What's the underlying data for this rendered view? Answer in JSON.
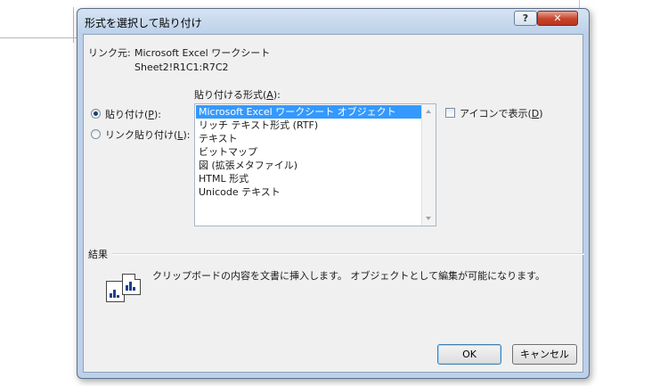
{
  "dialog": {
    "title": "形式を選択して貼り付け",
    "help_label": "?",
    "close_label": "✕"
  },
  "link": {
    "label": "リンク元:",
    "source": "Microsoft Excel ワークシート",
    "range": "Sheet2!R1C1:R7C2"
  },
  "paste_format": {
    "label": "貼り付ける形式(",
    "accesskey": "A",
    "label_end": "):"
  },
  "options": {
    "paste": {
      "label": "貼り付け(",
      "accesskey": "P",
      "label_end": "):",
      "selected": true
    },
    "paste_link": {
      "label": "リンク貼り付け(",
      "accesskey": "L",
      "label_end": "):",
      "selected": false
    }
  },
  "format_list": [
    {
      "label": "Microsoft Excel ワークシート オブジェクト",
      "selected": true
    },
    {
      "label": "リッチ テキスト形式 (RTF)"
    },
    {
      "label": "テキスト"
    },
    {
      "label": "ビットマップ"
    },
    {
      "label": "図 (拡張メタファイル)"
    },
    {
      "label": "HTML 形式"
    },
    {
      "label": "Unicode テキスト"
    }
  ],
  "display_as_icon": {
    "label": "アイコンで表示(",
    "accesskey": "D",
    "label_end": ")",
    "checked": false
  },
  "result": {
    "heading": "結果",
    "description": "クリップボードの内容を文書に挿入します。 オブジェクトとして編集が可能になります。",
    "icon": "paste-object-icon"
  },
  "buttons": {
    "ok": "OK",
    "cancel": "キャンセル"
  },
  "colors": {
    "selection": "#3399ff",
    "dialog_frame": "#bcd1e9",
    "client_bg": "#f0f0f0"
  }
}
